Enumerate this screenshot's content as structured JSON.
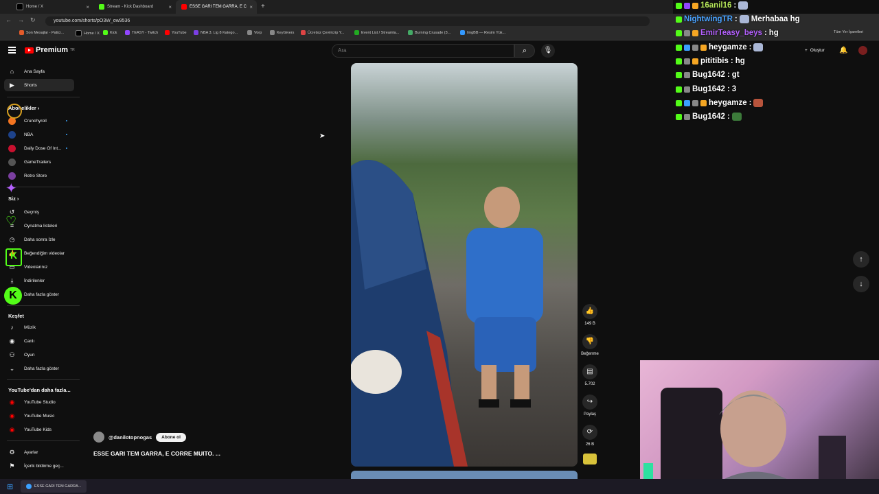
{
  "browser": {
    "tabs": [
      {
        "label": "Home / X"
      },
      {
        "label": "Stream - Kick Dashboard"
      },
      {
        "label": "ESSE GARI TEM GARRA, E C"
      }
    ],
    "url": "youtube.com/shorts/pO3W_ow9536",
    "bookmarks": [
      "Son Mesajlar - Patici...",
      "Home / X",
      "Kick",
      "TEASY - Twitch",
      "YouTube",
      "NBA 3. Lig 8 Katego...",
      "Vorp",
      "KeyGivers",
      "Ücretsiz Çeviricrip Y...",
      "Event List / Streamla...",
      "Burning Crusade (3...",
      "ImgBB — Resim Yük..."
    ],
    "bookmarks_right": "Tüm Yer İşaretleri"
  },
  "youtube": {
    "logo_text": "Premium",
    "logo_sup": "TR",
    "search_placeholder": "Ara",
    "create_label": "Oluştur",
    "sidebar": {
      "main": [
        {
          "label": "Ana Sayfa",
          "icon": "home-icon"
        },
        {
          "label": "Shorts",
          "icon": "shorts-icon"
        }
      ],
      "subscriptions_header": "Abonelikler",
      "subscriptions": [
        {
          "label": "Crunchyroll",
          "color": "#f47521"
        },
        {
          "label": "NBA",
          "color": "#1d428a"
        },
        {
          "label": "Daily Dose Of Int...",
          "color": "#c8102e"
        },
        {
          "label": "GameTrailers",
          "color": "#555555"
        },
        {
          "label": "Retro Store",
          "color": "#7b3fa0"
        }
      ],
      "you_header": "Siz",
      "you": [
        {
          "label": "Geçmiş"
        },
        {
          "label": "Oynatma listeleri"
        },
        {
          "label": "Daha sonra İzle"
        },
        {
          "label": "Beğendiğim videolar"
        },
        {
          "label": "Videolarınız"
        },
        {
          "label": "İndirilenler"
        },
        {
          "label": "Daha fazla göster"
        }
      ],
      "explore_header": "Keşfet",
      "explore": [
        {
          "label": "Müzik"
        },
        {
          "label": "Canlı"
        },
        {
          "label": "Oyun"
        },
        {
          "label": "Daha fazla göster"
        }
      ],
      "more_header": "YouTube'dan daha fazla...",
      "more": [
        {
          "label": "YouTube Studio"
        },
        {
          "label": "YouTube Music"
        },
        {
          "label": "YouTube Kids"
        }
      ],
      "bottom": [
        {
          "label": "Ayarlar"
        },
        {
          "label": "İçerik bildirme geç..."
        }
      ]
    },
    "short": {
      "channel": "@danilotopnogas",
      "subscribe_label": "Abone ol",
      "title": "ESSE GARI TEM GARRA, E CORRE MUITO. ...",
      "actions": [
        {
          "label": "149 B",
          "icon": "like-icon"
        },
        {
          "label": "Beğenme",
          "icon": "dislike-icon"
        },
        {
          "label": "5.702",
          "icon": "comment-icon"
        },
        {
          "label": "Paylaş",
          "icon": "share-icon"
        },
        {
          "label": "26 B",
          "icon": "remix-icon"
        }
      ]
    }
  },
  "chat": [
    {
      "user": "16anil16",
      "msg": "",
      "color": "#b7e85a"
    },
    {
      "user": "NightwingTR",
      "msg": "Merhabaa hg",
      "color": "#4aa3ff"
    },
    {
      "user": "EmirTeasy_beys",
      "msg": "hg",
      "color": "#b561ff"
    },
    {
      "user": "heygamze",
      "msg": "",
      "color": "#ffffff"
    },
    {
      "user": "pititibis",
      "msg": "hg",
      "color": "#ffffff"
    },
    {
      "user": "Bug1642",
      "msg": "gt",
      "color": "#ffffff"
    },
    {
      "user": "Bug1642",
      "msg": "3",
      "color": "#ffffff"
    },
    {
      "user": "heygamze",
      "msg": "",
      "color": "#ffffff"
    },
    {
      "user": "Bug1642",
      "msg": "",
      "color": "#ffffff"
    }
  ],
  "taskbar": {
    "app_label": "ESSE GARI TEM GARRA..."
  }
}
